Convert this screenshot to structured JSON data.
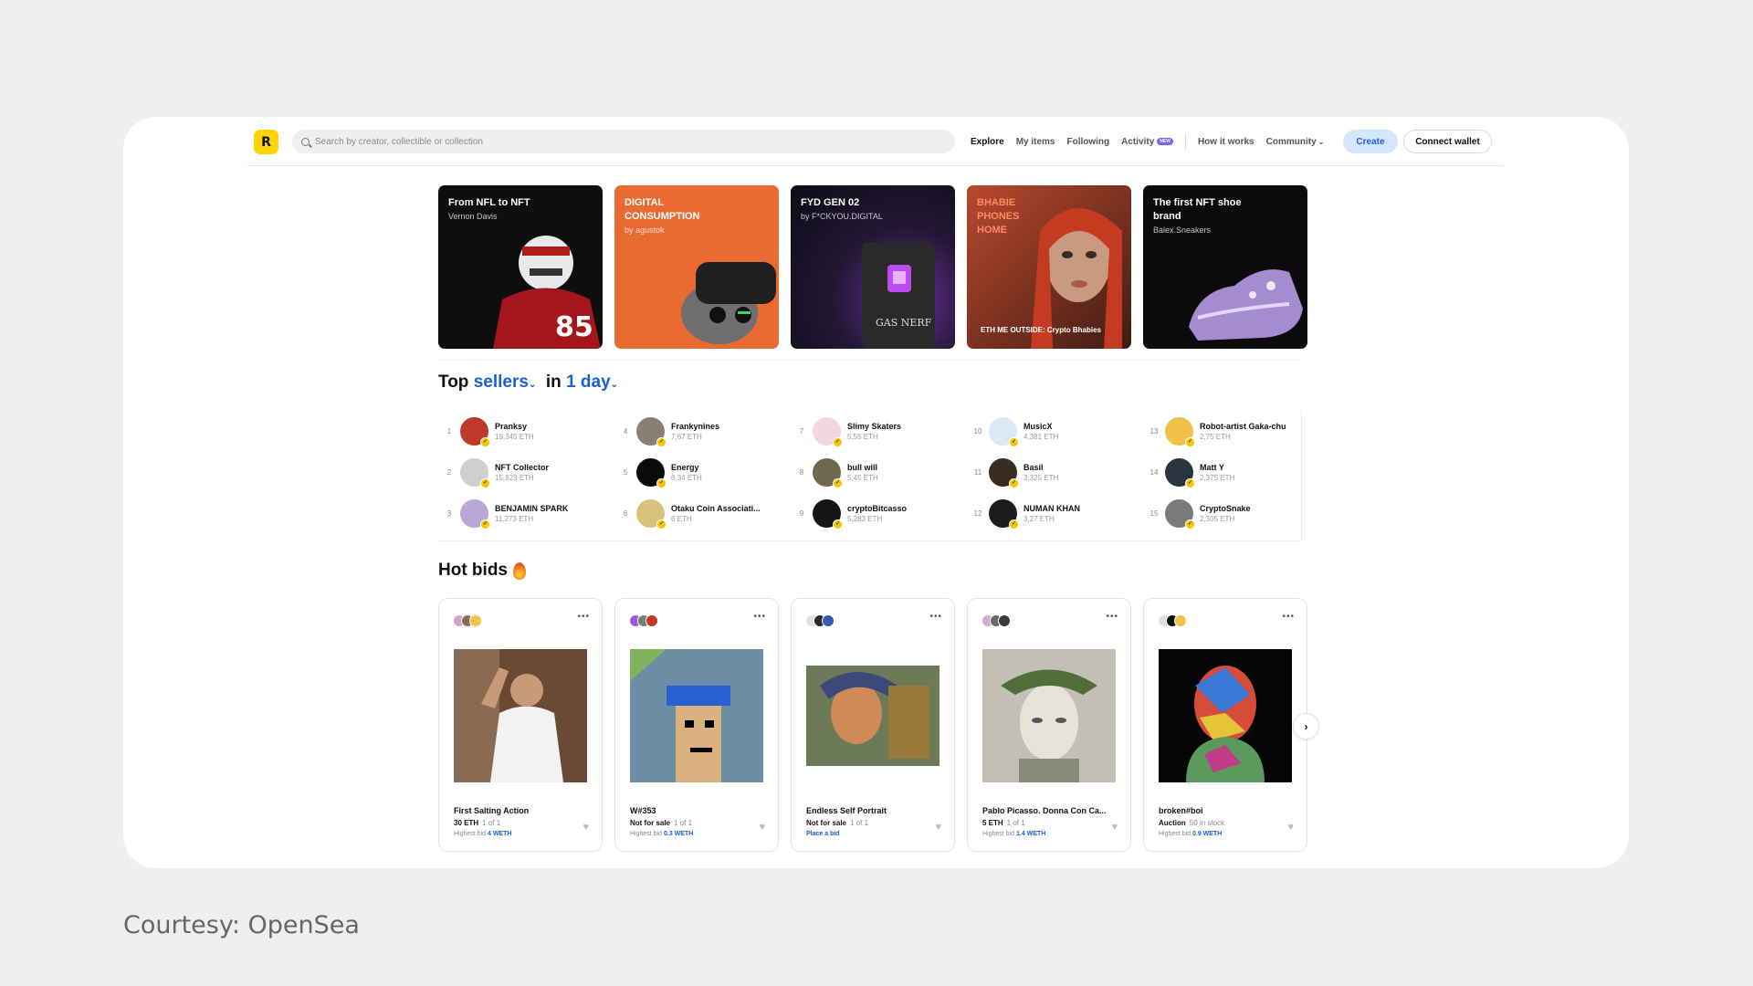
{
  "header": {
    "logo_letter": "R",
    "search_placeholder": "Search by creator, collectible or collection",
    "nav": [
      {
        "label": "Explore",
        "active": true
      },
      {
        "label": "My items"
      },
      {
        "label": "Following"
      },
      {
        "label": "Activity",
        "badge": "NEW"
      }
    ],
    "nav_right": [
      {
        "label": "How it works"
      },
      {
        "label": "Community"
      }
    ],
    "create_label": "Create",
    "wallet_label": "Connect wallet"
  },
  "banners": [
    {
      "title": "From NFL to NFT",
      "subtitle": "Vernon Davis"
    },
    {
      "title": "DIGITAL CONSUMPTION",
      "subtitle": "by agustok"
    },
    {
      "title": "FYD GEN 02",
      "subtitle": "by F*CKYOU.DIGITAL",
      "art_text": "GAS NERF"
    },
    {
      "title": "BHABIE PHONES HOME",
      "bottom": "ETH ME OUTSIDE: Crypto Bhabies"
    },
    {
      "title": "The first NFT shoe brand",
      "subtitle": "Balex.Sneakers"
    }
  ],
  "top_sellers": {
    "prefix": "Top",
    "kind": "sellers",
    "in": "in",
    "period": "1 day",
    "sellers": [
      {
        "rank": "1",
        "name": "Pranksy",
        "eth": "19,345 ETH",
        "color": "#c0392b"
      },
      {
        "rank": "2",
        "name": "NFT Collector",
        "eth": "15,823 ETH",
        "color": "#cfcfcf"
      },
      {
        "rank": "3",
        "name": "BENJAMIN SPARK",
        "eth": "11,273 ETH",
        "color": "#b9a7d6"
      },
      {
        "rank": "4",
        "name": "Frankynines",
        "eth": "7,67 ETH",
        "color": "#8a7f74"
      },
      {
        "rank": "5",
        "name": "Energy",
        "eth": "6,34 ETH",
        "color": "#0a0a0a"
      },
      {
        "rank": "6",
        "name": "Otaku Coin Associati...",
        "eth": "6 ETH",
        "color": "#d9c37a"
      },
      {
        "rank": "7",
        "name": "Slimy Skaters",
        "eth": "5,55 ETH",
        "color": "#f3d6e2"
      },
      {
        "rank": "8",
        "name": "bull will",
        "eth": "5,45 ETH",
        "color": "#6e6a52"
      },
      {
        "rank": "9",
        "name": "cryptoBitcasso",
        "eth": "5,283 ETH",
        "color": "#151515"
      },
      {
        "rank": "10",
        "name": "MusicX",
        "eth": "4,381 ETH",
        "color": "#dbe8f5"
      },
      {
        "rank": "11",
        "name": "Basil",
        "eth": "3,325 ETH",
        "color": "#3a2a22"
      },
      {
        "rank": "12",
        "name": "NUMAN KHAN",
        "eth": "3,27 ETH",
        "color": "#1b1b1b"
      },
      {
        "rank": "13",
        "name": "Robot-artist Gaka-chu",
        "eth": "2,75 ETH",
        "color": "#f0c24a"
      },
      {
        "rank": "14",
        "name": "Matt Y",
        "eth": "2,375 ETH",
        "color": "#2a3440"
      },
      {
        "rank": "15",
        "name": "CryptoSnake",
        "eth": "2,305 ETH",
        "color": "#7a7a7a"
      }
    ]
  },
  "hot_bids": {
    "title": "Hot bids",
    "cards": [
      {
        "title": "First Salting Action",
        "price": "30 ETH",
        "edition": "1 of 1",
        "bid_label": "Highest bid",
        "bid_value": "4 WETH",
        "img": "salt"
      },
      {
        "title": "W#353",
        "price": "Not for sale",
        "edition": "1 of 1",
        "bid_label": "Highest bid",
        "bid_value": "0.3 WETH",
        "img": "punk"
      },
      {
        "title": "Endless Self Portrait",
        "price": "Not for sale",
        "edition": "1 of 1",
        "bid_label": "",
        "bid_value": "Place a bid",
        "img": "portrait"
      },
      {
        "title": "Pablo Picasso. Donna Con Ca...",
        "price": "5 ETH",
        "edition": "1 of 1",
        "bid_label": "Highest bid",
        "bid_value": "1.4 WETH",
        "img": "picasso"
      },
      {
        "title": "broken#boi",
        "price": "Auction",
        "edition": "50 in stock",
        "bid_label": "Highest bid",
        "bid_value": "0.9 WETH",
        "img": "boi"
      }
    ]
  },
  "courtesy": "Courtesy: OpenSea"
}
